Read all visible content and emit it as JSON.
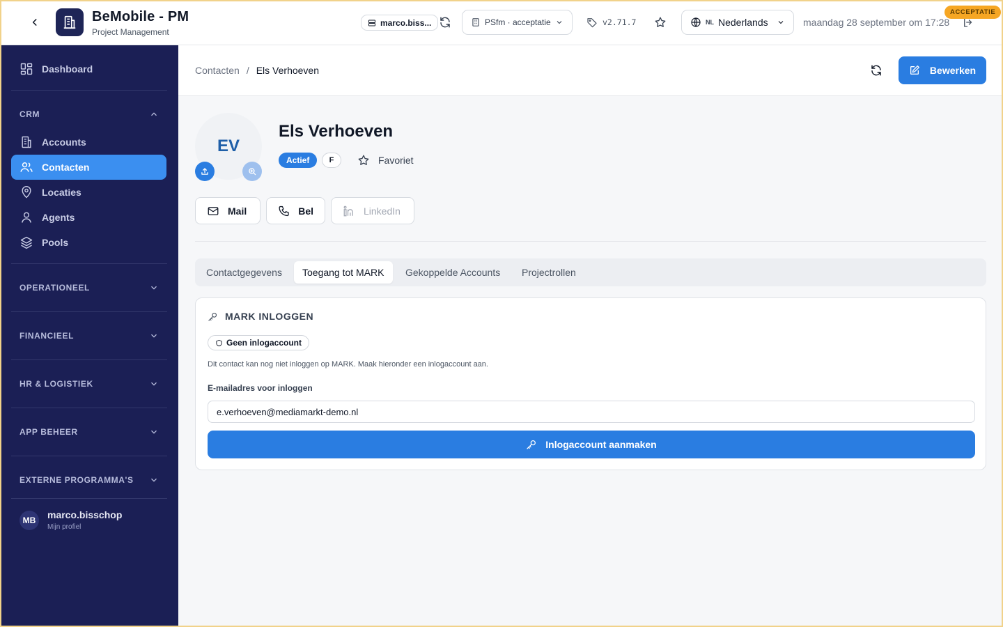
{
  "app": {
    "title": "BeMobile - PM",
    "subtitle": "Project Management"
  },
  "topbar": {
    "user_short": "marco.biss...",
    "environment": "PSfm · acceptatie",
    "version": "v2.71.7",
    "language_code": "NL",
    "language": "Nederlands",
    "datetime": "maandag 28 september om 17:28",
    "env_badge": "ACCEPTATIE"
  },
  "sidebar": {
    "dashboard": "Dashboard",
    "sections": {
      "crm": "CRM",
      "operationeel": "OPERATIONEEL",
      "financieel": "FINANCIEEL",
      "hr": "HR & LOGISTIEK",
      "app": "APP BEHEER",
      "extern": "EXTERNE PROGRAMMA'S"
    },
    "crm_items": {
      "accounts": "Accounts",
      "contacten": "Contacten",
      "locaties": "Locaties",
      "agents": "Agents",
      "pools": "Pools"
    },
    "profile": {
      "initials": "MB",
      "name": "marco.bisschop",
      "link": "Mijn profiel"
    }
  },
  "header": {
    "breadcrumb_parent": "Contacten",
    "breadcrumb_sep": "/",
    "breadcrumb_current": "Els Verhoeven",
    "edit_label": "Bewerken"
  },
  "contact": {
    "initials": "EV",
    "name": "Els Verhoeven",
    "status": "Actief",
    "gender": "F",
    "favorite_label": "Favoriet"
  },
  "actions": {
    "mail": "Mail",
    "call": "Bel",
    "linkedin": "LinkedIn"
  },
  "tabs": {
    "t1": "Contactgegevens",
    "t2": "Toegang tot MARK",
    "t3": "Gekoppelde Accounts",
    "t4": "Projectrollen"
  },
  "mark": {
    "title": "MARK INLOGGEN",
    "status": "Geen inlogaccount",
    "description": "Dit contact kan nog niet inloggen op MARK. Maak hieronder een inlogaccount aan.",
    "email_label": "E-mailadres voor inloggen",
    "email_value": "e.verhoeven@mediamarkt-demo.nl",
    "create_label": "Inlogaccount aanmaken"
  },
  "colors": {
    "sidebar_bg": "#1b1f55",
    "accent": "#2a7de1",
    "active_item": "#3b8ff0",
    "env_badge": "#f6a623"
  }
}
